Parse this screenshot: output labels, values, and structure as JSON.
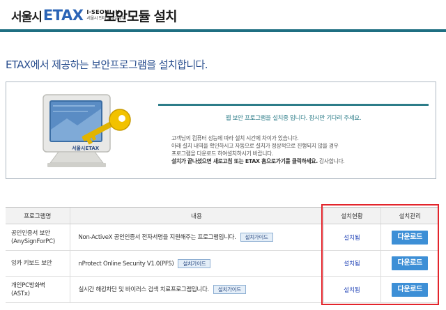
{
  "header": {
    "logo_seoul": "서울시",
    "logo_etax": "ETAX",
    "logo_sub_top": "I·SEOUL·U",
    "logo_sub_bottom": "서울시 인터넷 세금납부",
    "title": "보안모듈 설치"
  },
  "intro": "ETAX에서 제공하는 보안프로그램을 설치합니다.",
  "banner": {
    "monitor_label": "서울시ETAX",
    "progress": "웹 보안 프로그램을 설치중 입니다. 잠시만 기다려 주세요.",
    "notice_lines": [
      "고객님의 컴퓨터 성능에 따라 설치 시간에 차이가 있습니다.",
      "아래 설치 내역을 확인하시고 자동으로 설치가 정상적으로 진행되지 않을 경우",
      "프로그램을 다운로드 하여설치하시기 바랍니다."
    ],
    "notice_strong": "설치가 끝나셨으면 새로고침 또는 ETAX 홈으로가기를 클릭하세요.",
    "notice_tail": " 감사합니다."
  },
  "table": {
    "headers": [
      "프로그램명",
      "내용",
      "설치현황",
      "설치관리"
    ],
    "rows": [
      {
        "name_line1": "공인인증서 보안",
        "name_line2": "(AnySignForPC)",
        "desc": "Non-ActiveX 공인인증서 전자서명을 지원해주는 프로그램입니다.",
        "guide": "설치가이드",
        "status": "설치됨",
        "action": "다운로드"
      },
      {
        "name_line1": "잉카 키보드 보안",
        "name_line2": "",
        "desc": "nProtect Online Security V1.0(PFS)",
        "guide": "설치가이드",
        "status": "설치됨",
        "action": "다운로드"
      },
      {
        "name_line1": "개인PC방화벽",
        "name_line2": "(ASTx)",
        "desc": "실시간 해킹차단 및 바이러스 검색 치료프로그램입니다.",
        "guide": "설치가이드",
        "status": "설치됨",
        "action": "다운로드"
      }
    ]
  },
  "colors": {
    "accent": "#1f6f82",
    "etax_blue": "#2b64b6",
    "download_button": "#3d8fd6",
    "highlight_box": "#e3242b"
  }
}
